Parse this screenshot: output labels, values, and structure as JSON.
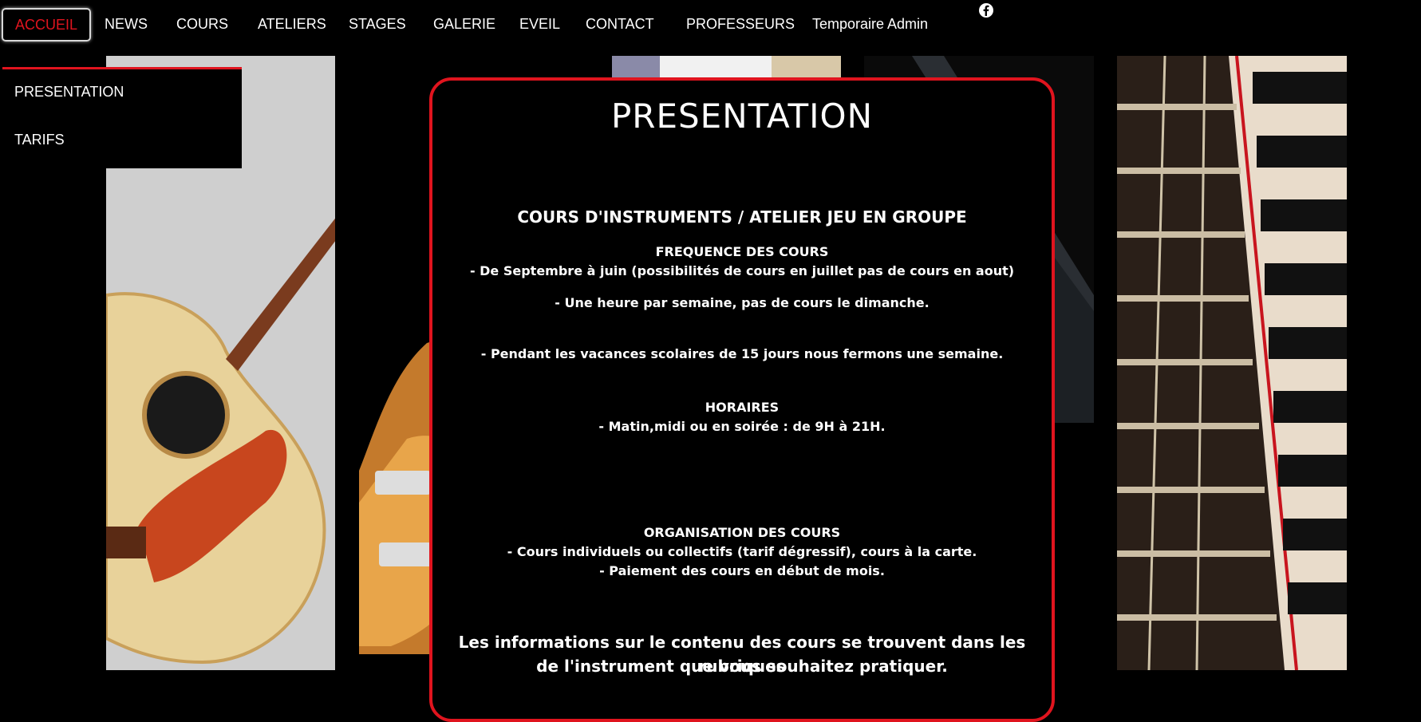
{
  "nav": {
    "items": [
      {
        "label": "ACCUEIL",
        "active": true
      },
      {
        "label": "NEWS"
      },
      {
        "label": "COURS"
      },
      {
        "label": "ATELIERS"
      },
      {
        "label": "STAGES"
      },
      {
        "label": "GALERIE"
      },
      {
        "label": "EVEIL"
      },
      {
        "label": "CONTACT"
      },
      {
        "label": "PROFESSEURS"
      },
      {
        "label": "Temporaire Admin"
      }
    ],
    "social_icon": "facebook-icon"
  },
  "dropdown": {
    "items": [
      "PRESENTATION",
      "TARIFS"
    ]
  },
  "content": {
    "title": "PRESENTATION",
    "subtitle": "COURS D'INSTRUMENTS / ATELIER JEU EN GROUPE",
    "frequence_heading": "FREQUENCE DES COURS",
    "frequence_1": "- De Septembre à juin (possibilités de cours en juillet pas de cours en aout)",
    "frequence_2": "- Une heure par semaine, pas de cours le dimanche.",
    "frequence_3": "- Pendant les vacances scolaires de 15 jours nous fermons une semaine.",
    "horaires_heading": "HORAIRES",
    "horaires_1": "- Matin,midi ou en soirée : de 9H à 21H.",
    "organisation_heading": "ORGANISATION DES COURS",
    "organisation_1": "- Cours individuels ou collectifs (tarif dégressif), cours à la carte.",
    "organisation_2": "- Paiement des cours en début de mois.",
    "closing_1": "Les informations sur le contenu des cours se trouvent dans les rubriques",
    "closing_2": "de l'instrument que vous souhaitez pratiquer."
  },
  "colors": {
    "accent": "#e0141e",
    "background": "#000000",
    "text": "#ffffff"
  }
}
